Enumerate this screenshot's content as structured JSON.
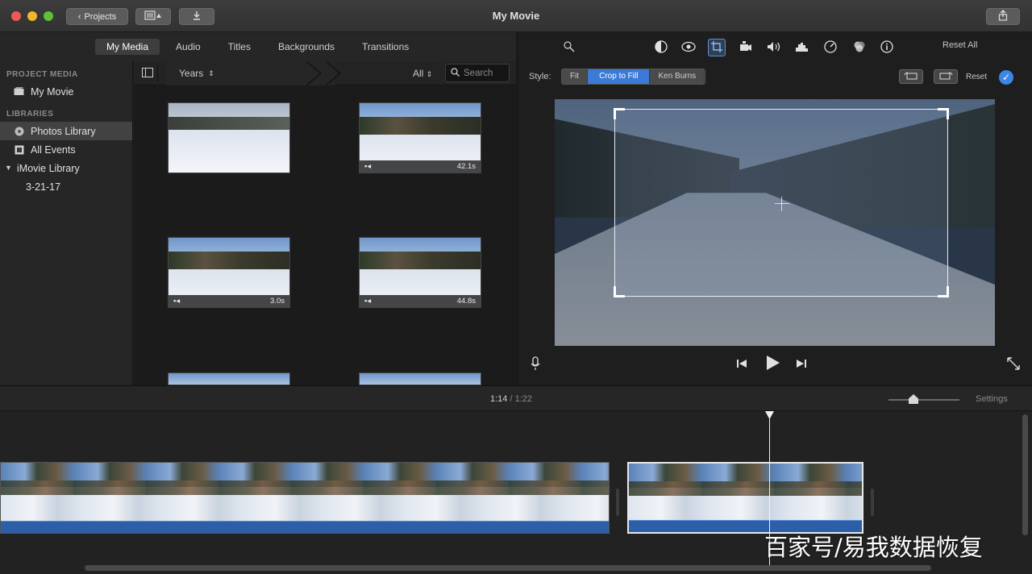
{
  "window": {
    "title": "My Movie"
  },
  "toolbar": {
    "projects_label": "Projects",
    "icons": [
      "media-browser-icon",
      "import-icon",
      "share-icon"
    ]
  },
  "tabs": [
    {
      "label": "My Media",
      "active": true
    },
    {
      "label": "Audio",
      "active": false
    },
    {
      "label": "Titles",
      "active": false
    },
    {
      "label": "Backgrounds",
      "active": false
    },
    {
      "label": "Transitions",
      "active": false
    }
  ],
  "sidebar": {
    "project_media_heading": "PROJECT MEDIA",
    "project_item": "My Movie",
    "libraries_heading": "LIBRARIES",
    "items": [
      {
        "label": "Photos Library",
        "selected": true,
        "icon": "photos-icon"
      },
      {
        "label": "All Events",
        "selected": false,
        "icon": "events-icon"
      },
      {
        "label": "iMovie Library",
        "selected": false,
        "icon": "disclosure-triangle-icon"
      },
      {
        "label": "3-21-17",
        "selected": false
      }
    ]
  },
  "filter": {
    "grouping": "Years",
    "filter_value": "All",
    "search_placeholder": "Search"
  },
  "media": [
    {
      "duration": ""
    },
    {
      "duration": "42.1s"
    },
    {
      "duration": "3.0s"
    },
    {
      "duration": "44.8s"
    }
  ],
  "viewer": {
    "reset_all_label": "Reset All",
    "style_label": "Style:",
    "crop_styles": [
      {
        "label": "Fit",
        "selected": false
      },
      {
        "label": "Crop to Fill",
        "selected": true
      },
      {
        "label": "Ken Burns",
        "selected": false
      }
    ],
    "reset_label": "Reset",
    "adjust_icons": [
      "magic-wand-icon",
      "color-balance-icon",
      "color-correction-icon",
      "crop-icon",
      "stabilization-icon",
      "volume-icon",
      "noise-reduction-icon",
      "speed-icon",
      "clip-filter-icon",
      "info-icon"
    ]
  },
  "timeline": {
    "current_time": "1:14",
    "separator": "/",
    "total_time": "1:22",
    "settings_label": "Settings"
  },
  "watermark": "百家号/易我数据恢复",
  "colors": {
    "accent": "#3b7ad6",
    "audio_track": "#2d5ea8",
    "window_bg": "#1e1e1e"
  }
}
